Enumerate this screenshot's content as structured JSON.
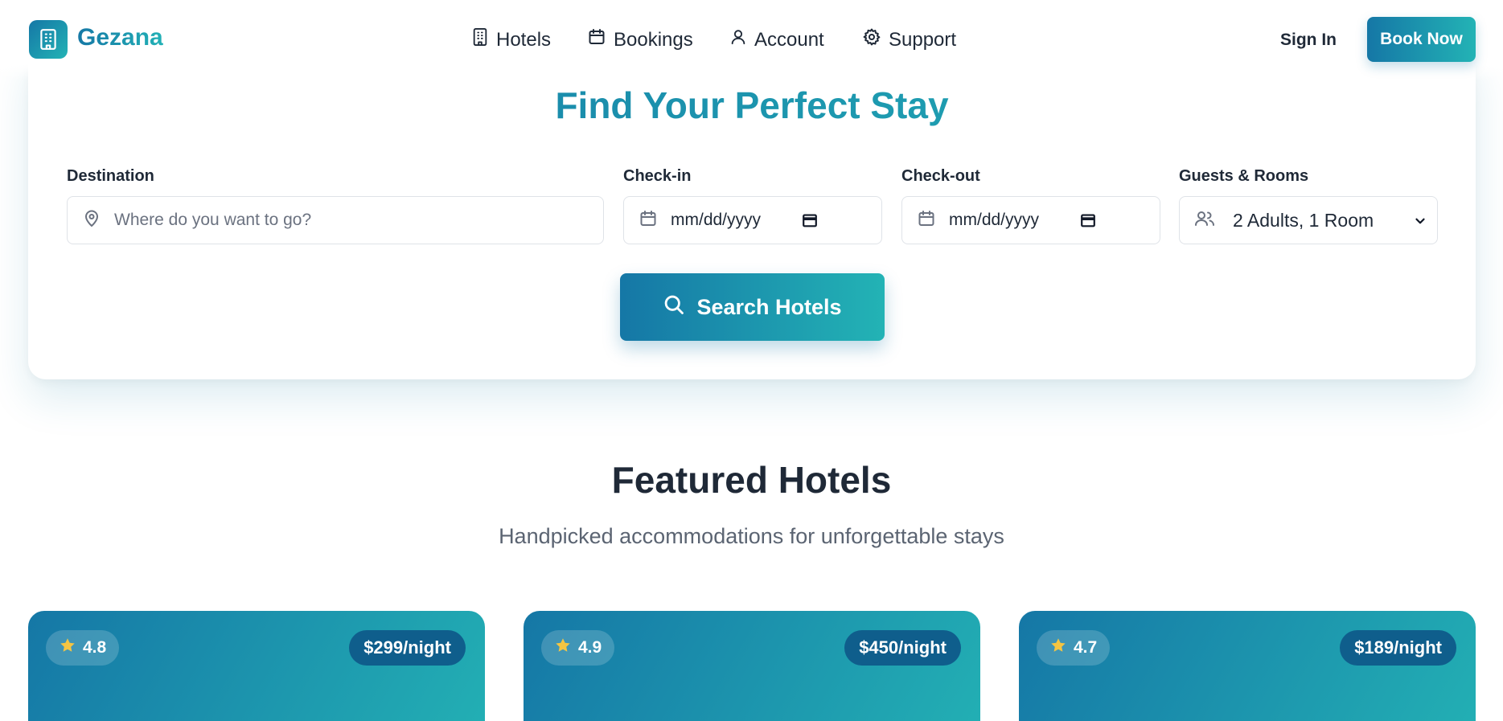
{
  "brand": {
    "name": "Gezana"
  },
  "nav": {
    "links": [
      {
        "label": "Hotels",
        "icon": "building-icon"
      },
      {
        "label": "Bookings",
        "icon": "calendar-icon"
      },
      {
        "label": "Account",
        "icon": "user-icon"
      },
      {
        "label": "Support",
        "icon": "gear-icon"
      }
    ],
    "signin_label": "Sign In",
    "book_now_label": "Book Now"
  },
  "search": {
    "title": "Find Your Perfect Stay",
    "destination": {
      "label": "Destination",
      "placeholder": "Where do you want to go?"
    },
    "checkin": {
      "label": "Check-in",
      "value": "mm/dd/yyyy"
    },
    "checkout": {
      "label": "Check-out",
      "value": "mm/dd/yyyy"
    },
    "guests": {
      "label": "Guests & Rooms",
      "selected": "2 Adults, 1 Room"
    },
    "button_label": "Search Hotels"
  },
  "featured": {
    "title": "Featured Hotels",
    "subtitle": "Handpicked accommodations for unforgettable stays",
    "hotels": [
      {
        "rating": "4.8",
        "price": "$299/night"
      },
      {
        "rating": "4.9",
        "price": "$450/night"
      },
      {
        "rating": "4.7",
        "price": "$189/night"
      }
    ]
  },
  "colors": {
    "brand_start": "#1577a6",
    "brand_end": "#23b3b5",
    "star": "#f5c542"
  }
}
